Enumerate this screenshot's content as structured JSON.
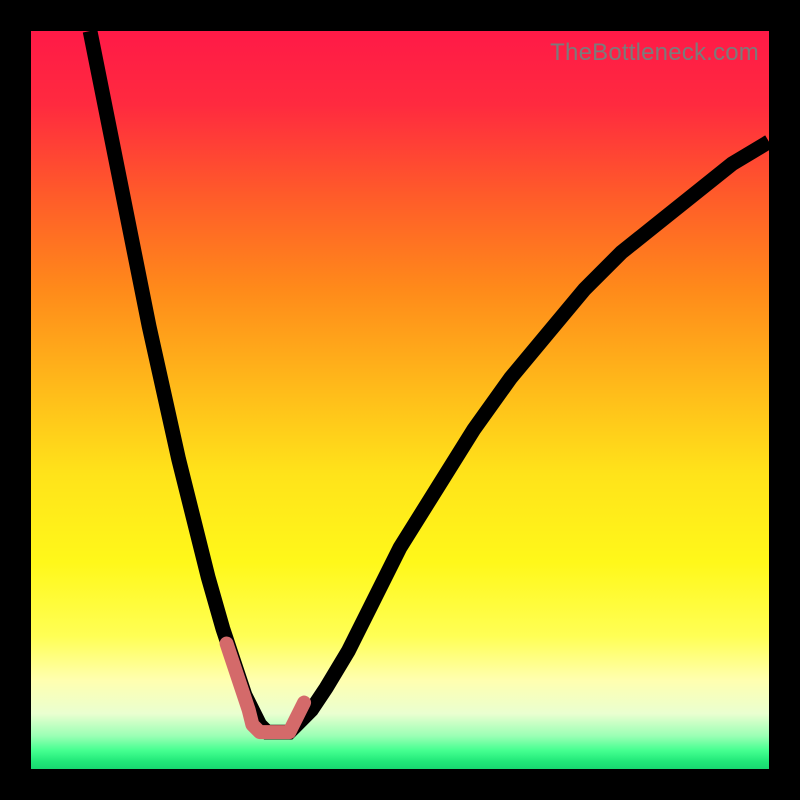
{
  "watermark": "TheBottleneck.com",
  "gradient": {
    "stops": [
      {
        "offset": 0.0,
        "color": "#ff1a47"
      },
      {
        "offset": 0.1,
        "color": "#ff2a3f"
      },
      {
        "offset": 0.22,
        "color": "#ff5a2a"
      },
      {
        "offset": 0.35,
        "color": "#ff8a1a"
      },
      {
        "offset": 0.48,
        "color": "#ffb91a"
      },
      {
        "offset": 0.6,
        "color": "#ffe31a"
      },
      {
        "offset": 0.72,
        "color": "#fff81a"
      },
      {
        "offset": 0.82,
        "color": "#ffff55"
      },
      {
        "offset": 0.88,
        "color": "#ffffb0"
      },
      {
        "offset": 0.925,
        "color": "#eaffd0"
      },
      {
        "offset": 0.955,
        "color": "#9bffb5"
      },
      {
        "offset": 0.975,
        "color": "#45ff90"
      },
      {
        "offset": 0.99,
        "color": "#20e878"
      },
      {
        "offset": 1.0,
        "color": "#18d870"
      }
    ]
  },
  "chart_data": {
    "type": "line",
    "title": "",
    "xlabel": "",
    "ylabel": "",
    "xlim": [
      0,
      100
    ],
    "ylim": [
      0,
      100
    ],
    "grid": false,
    "legend": false,
    "series": [
      {
        "name": "bottleneck-curve",
        "x": [
          8,
          10,
          12,
          14,
          16,
          18,
          20,
          22,
          24,
          26,
          27,
          28,
          29,
          30,
          31,
          32,
          33,
          34,
          35,
          36,
          38,
          40,
          43,
          46,
          50,
          55,
          60,
          65,
          70,
          75,
          80,
          85,
          90,
          95,
          100
        ],
        "y": [
          100,
          90,
          80,
          70,
          60,
          51,
          42,
          34,
          26,
          19,
          16,
          13,
          10,
          8,
          6,
          5,
          5,
          5,
          5,
          6,
          8,
          11,
          16,
          22,
          30,
          38,
          46,
          53,
          59,
          65,
          70,
          74,
          78,
          82,
          85
        ]
      }
    ],
    "annotations": [
      {
        "name": "highlighted-minimum-region",
        "x": [
          26.5,
          27.5,
          28.5,
          29.5,
          30.0,
          31.0,
          32.0,
          33.0,
          34.0,
          35.0,
          35.5,
          36.0,
          37.0
        ],
        "y": [
          17,
          14,
          11,
          8,
          6,
          5,
          5,
          5,
          5,
          5,
          6,
          7,
          9
        ]
      }
    ]
  }
}
